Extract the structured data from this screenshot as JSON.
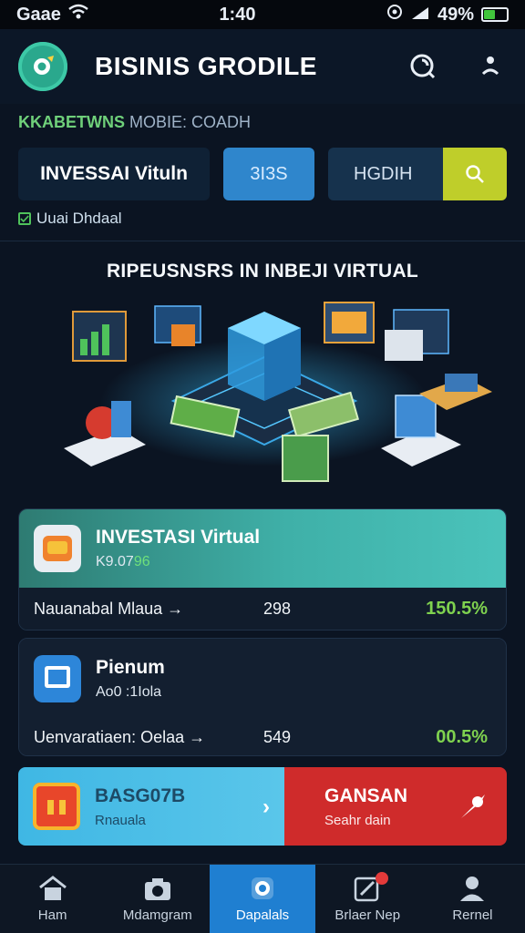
{
  "status_bar": {
    "carrier": "Gaae",
    "time": "1:40",
    "battery_percent": "49%",
    "battery_level": 0.49
  },
  "header": {
    "title": "BISINIS GRODILE",
    "subtitle_brand": "KKABETWNS",
    "subtitle_rest": " MOBIE: COADH"
  },
  "actions": {
    "invest_label": "INVESSAI Vituln",
    "stats_label": "3I3S",
    "search_value": "HGDIH"
  },
  "checkbox": {
    "label": "Uuai Dhdaal",
    "checked": true
  },
  "hero": {
    "title": "RIPEUSNSRS IN INBEJI VIRTUAL"
  },
  "cards": [
    {
      "name": "INVESTASI Virtual",
      "code_prefix": "K9.07",
      "code_highlight": "96",
      "metric": "Nauanabal Mlaua →",
      "count": "298",
      "percent": "150.5%"
    },
    {
      "name": "Pienum",
      "code": "Ao0 :1Iola",
      "metric": "Uenvaratiaen: Oelaa →",
      "count": "549",
      "percent": "00.5%"
    }
  ],
  "promo": {
    "left_title": "BASG07B",
    "left_sub": "Rnauala",
    "right_title": "GANSAN",
    "right_sub": "Seahr dain"
  },
  "nav": [
    {
      "label": "Ham",
      "icon": "home-icon"
    },
    {
      "label": "Mdamgram",
      "icon": "camera-icon"
    },
    {
      "label": "Dapalals",
      "icon": "tag-icon"
    },
    {
      "label": "Brlaer Nep",
      "icon": "edit-icon"
    },
    {
      "label": "Rernel",
      "icon": "profile-icon"
    }
  ],
  "colors": {
    "background": "#0b1422",
    "accent": "#1f7fd1",
    "positive": "#7fd24f",
    "brand_teal": "#2aa88d",
    "search_button": "#bfce2a",
    "promo_red": "#cf2b2b"
  }
}
